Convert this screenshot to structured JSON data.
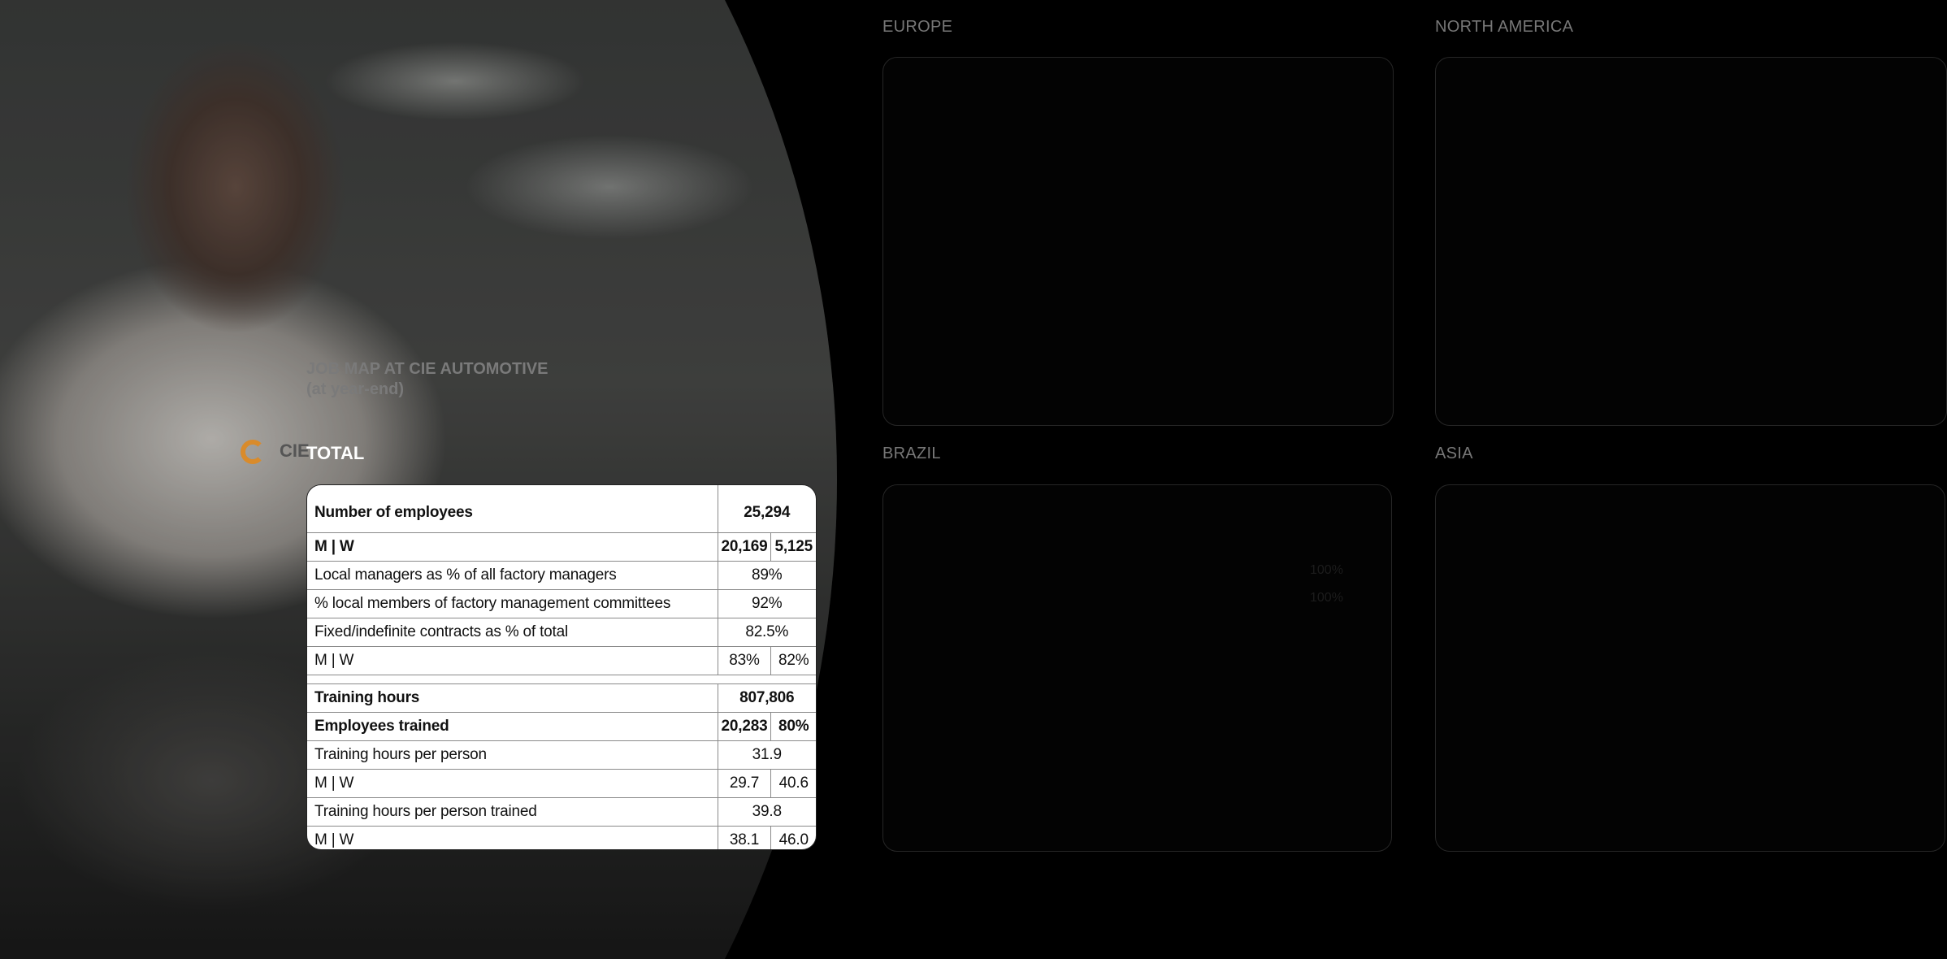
{
  "header": {
    "title_line1": "JOB MAP AT CIE AUTOMOTIVE",
    "title_line2": "(at year-end)",
    "total_label": "TOTAL"
  },
  "photo": {
    "logo_text": "CIE"
  },
  "table": {
    "rows": [
      {
        "label": "Number of employees",
        "value": "25,294"
      },
      {
        "label": "M | W",
        "m": "20,169",
        "w": "5,125"
      },
      {
        "label": "Local managers as % of all factory managers",
        "value": "89%"
      },
      {
        "label": "% local members of factory management committees",
        "value": "92%"
      },
      {
        "label": "Fixed/indefinite contracts as % of total",
        "value": "82.5%"
      },
      {
        "label": "M | W",
        "m": "83%",
        "w": "82%"
      },
      {
        "label": "Training hours",
        "value": "807,806"
      },
      {
        "label": "Employees trained",
        "m": "20,283",
        "w": "80%"
      },
      {
        "label": "Training hours per person",
        "value": "31.9"
      },
      {
        "label": "M | W",
        "m": "29.7",
        "w": "40.6"
      },
      {
        "label": "Training hours per person trained",
        "value": "39.8"
      },
      {
        "label": "M | W",
        "m": "38.1",
        "w": "46.0"
      }
    ]
  },
  "regions": {
    "europe": "EUROPE",
    "north_america": "NORTH AMERICA",
    "brazil": "BRAZIL",
    "asia": "ASIA",
    "brazil_ghost_1": "100%",
    "brazil_ghost_2": "100%"
  }
}
